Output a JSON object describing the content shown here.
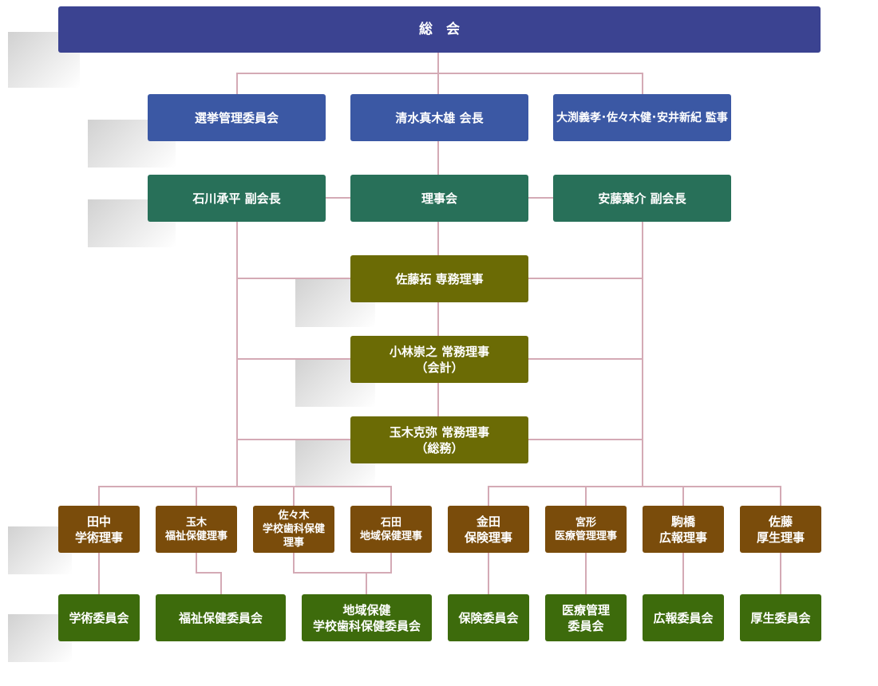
{
  "general_assembly": "総　会",
  "row1": {
    "election": "選挙管理委員会",
    "president": "清水真木雄 会長",
    "auditors": "大渕義孝･佐々木健･安井新紀 監事"
  },
  "row2": {
    "vp_left": "石川承平 副会長",
    "board": "理事会",
    "vp_right": "安藤葉介 副会長"
  },
  "managing": {
    "senmu": "佐藤拓 専務理事",
    "jomu_accounting": "小林崇之 常務理事\n（会計）",
    "jomu_general": "玉木克弥 常務理事\n（総務）"
  },
  "directors": {
    "academic": "田中\n学術理事",
    "welfare": "玉木\n福祉保健理事",
    "school": "佐々木\n学校歯科保健\n理事",
    "regional": "石田\n地域保健理事",
    "insurance": "金田\n保険理事",
    "medical": "宮形\n医療管理理事",
    "pr": "駒橋\n広報理事",
    "benefit": "佐藤\n厚生理事"
  },
  "committees": {
    "academic": "学術委員会",
    "welfare": "福祉保健委員会",
    "regional_school": "地域保健\n学校歯科保健委員会",
    "insurance": "保険委員会",
    "medical": "医療管理\n委員会",
    "pr": "広報委員会",
    "benefit": "厚生委員会"
  },
  "colors": {
    "assembly": "#3b4391",
    "executive": "#3b58a4",
    "board": "#287059",
    "managing": "#6b6b05",
    "directors": "#7a4c0b",
    "committees": "#3d6b0c",
    "connector": "#d4aab5"
  }
}
